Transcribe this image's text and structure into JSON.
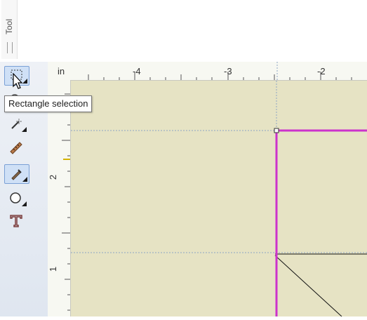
{
  "tool_window": {
    "title": "Tool"
  },
  "tools": [
    {
      "name": "rectangle-selection",
      "active": false
    },
    {
      "name": "zoom",
      "active": false
    },
    {
      "name": "magic-wand",
      "active": false
    },
    {
      "name": "measure",
      "active": false
    },
    {
      "name": "draw",
      "active": true
    },
    {
      "name": "shape-ellipse",
      "active": false
    },
    {
      "name": "text",
      "active": false
    }
  ],
  "tooltip": {
    "text": "Rectangle selection"
  },
  "ruler": {
    "unit": "in",
    "top_labels": [
      "-4",
      "-3",
      "-2"
    ],
    "left_labels": [
      "2",
      "1"
    ]
  },
  "colors": {
    "canvas": "#e6e3c4",
    "selection_outline": "#cc33cc",
    "guide": "#8fa6c4",
    "ruler_marker": "#d4b400"
  }
}
